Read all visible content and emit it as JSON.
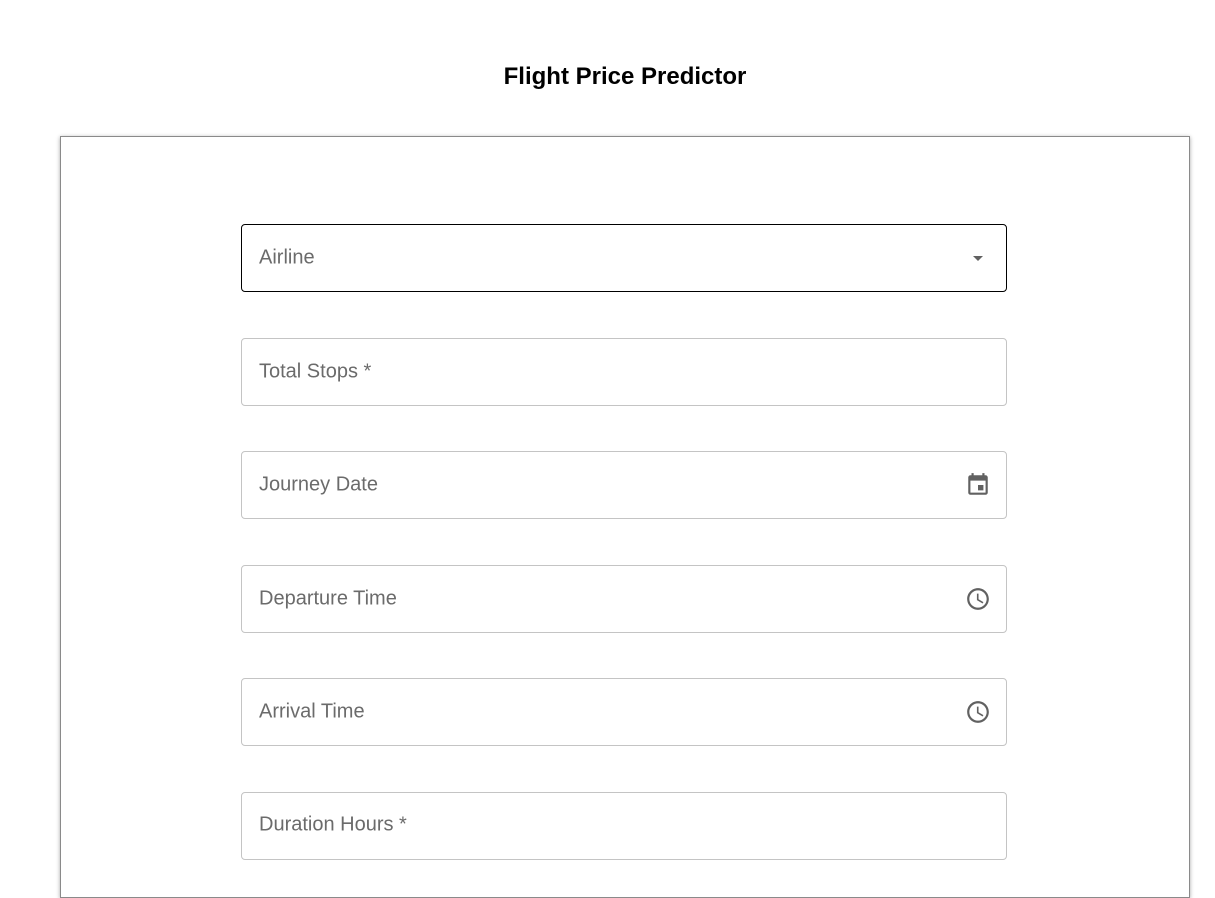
{
  "header": {
    "title": "Flight Price Predictor"
  },
  "form": {
    "airline": {
      "label": "Airline",
      "icon": "dropdown-arrow-icon"
    },
    "total_stops": {
      "label": "Total Stops *"
    },
    "journey_date": {
      "label": "Journey Date",
      "icon": "calendar-icon"
    },
    "departure_time": {
      "label": "Departure Time",
      "icon": "clock-icon"
    },
    "arrival_time": {
      "label": "Arrival Time",
      "icon": "clock-icon"
    },
    "duration_hours": {
      "label": "Duration Hours *"
    }
  },
  "colors": {
    "label": "#6b6b6b",
    "icon": "#616161",
    "border": "#c4c4c4",
    "focused_border": "#000000"
  }
}
